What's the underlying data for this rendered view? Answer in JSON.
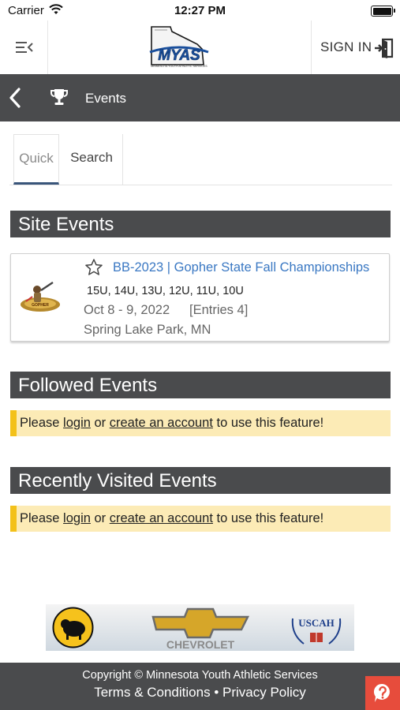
{
  "status_bar": {
    "carrier": "Carrier",
    "time": "12:27 PM"
  },
  "header": {
    "logo_text": "MYAS",
    "logo_subtext": "MINNESOTA YOUTH ATHLETIC SERVICES",
    "sign_in_label": "SIGN IN"
  },
  "nav": {
    "title": "Events"
  },
  "tabs": [
    {
      "label": "Quick",
      "active": true
    },
    {
      "label": "Search",
      "active": false
    }
  ],
  "sections": {
    "site_events": "Site Events",
    "followed_events": "Followed Events",
    "recently_visited": "Recently Visited Events"
  },
  "event": {
    "title": "BB-2023 | Gopher State Fall Championships",
    "ages": "15U, 14U, 13U, 12U, 11U, 10U",
    "dates": "Oct 8 - 9, 2022",
    "entries": "[Entries 4]",
    "location": "Spring Lake Park, MN"
  },
  "notice": {
    "prefix": "Please ",
    "login": "login",
    "middle": " or ",
    "create": "create an account",
    "suffix": " to use this feature!"
  },
  "sponsors": {
    "chevrolet": "CHEVROLET",
    "uscah": "USCAH"
  },
  "footer": {
    "copyright": "Copyright © Minnesota Youth Athletic Services",
    "terms": "Terms & Conditions",
    "separator": "•",
    "privacy": "Privacy Policy"
  },
  "colors": {
    "dark_bar": "#4a4b4d",
    "link_blue": "#3a78c3",
    "notice_bg": "#fcebb6",
    "notice_accent": "#f3c11a",
    "help_red": "#e74c3c",
    "tab_underline": "#39557a"
  }
}
